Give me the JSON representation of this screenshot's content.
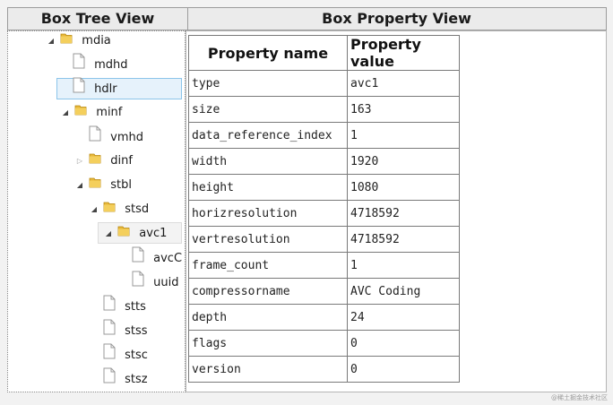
{
  "headers": {
    "tree": "Box Tree View",
    "properties": "Box Property View"
  },
  "tree": {
    "nodes": [
      {
        "label": "mdia",
        "kind": "folder",
        "expander": "expanded"
      },
      {
        "label": "mdhd",
        "kind": "file",
        "expander": "none"
      },
      {
        "label": "hdlr",
        "kind": "file",
        "expander": "none",
        "selected": true
      },
      {
        "label": "minf",
        "kind": "folder",
        "expander": "expanded"
      },
      {
        "label": "vmhd",
        "kind": "file",
        "expander": "none"
      },
      {
        "label": "dinf",
        "kind": "folder",
        "expander": "collapsed"
      },
      {
        "label": "stbl",
        "kind": "folder",
        "expander": "expanded"
      },
      {
        "label": "stsd",
        "kind": "folder",
        "expander": "expanded"
      },
      {
        "label": "avc1",
        "kind": "folder",
        "expander": "expanded",
        "hovered": true
      },
      {
        "label": "avcC",
        "kind": "file",
        "expander": "none"
      },
      {
        "label": "uuid",
        "kind": "file",
        "expander": "none"
      },
      {
        "label": "stts",
        "kind": "file",
        "expander": "none"
      },
      {
        "label": "stss",
        "kind": "file",
        "expander": "none"
      },
      {
        "label": "stsc",
        "kind": "file",
        "expander": "none"
      },
      {
        "label": "stsz",
        "kind": "file",
        "expander": "none"
      }
    ]
  },
  "properties": {
    "columns": [
      "Property name",
      "Property value"
    ],
    "rows": [
      [
        "type",
        "avc1"
      ],
      [
        "size",
        "163"
      ],
      [
        "data_reference_index",
        "1"
      ],
      [
        "width",
        "1920"
      ],
      [
        "height",
        "1080"
      ],
      [
        "horizresolution",
        "4718592"
      ],
      [
        "vertresolution",
        "4718592"
      ],
      [
        "frame_count",
        "1"
      ],
      [
        "compressorname",
        "AVC Coding"
      ],
      [
        "depth",
        "24"
      ],
      [
        "flags",
        "0"
      ],
      [
        "version",
        "0"
      ]
    ]
  },
  "icons": {
    "folder": "folder-icon",
    "file": "file-icon",
    "expanded": "triangle-expanded-icon",
    "collapsed": "triangle-collapsed-icon"
  },
  "colors": {
    "selection_bg": "#e6f2fb",
    "selection_border": "#8cc5ea",
    "folder": "#e8b83a"
  },
  "watermark": "@稀土掘金技术社区"
}
